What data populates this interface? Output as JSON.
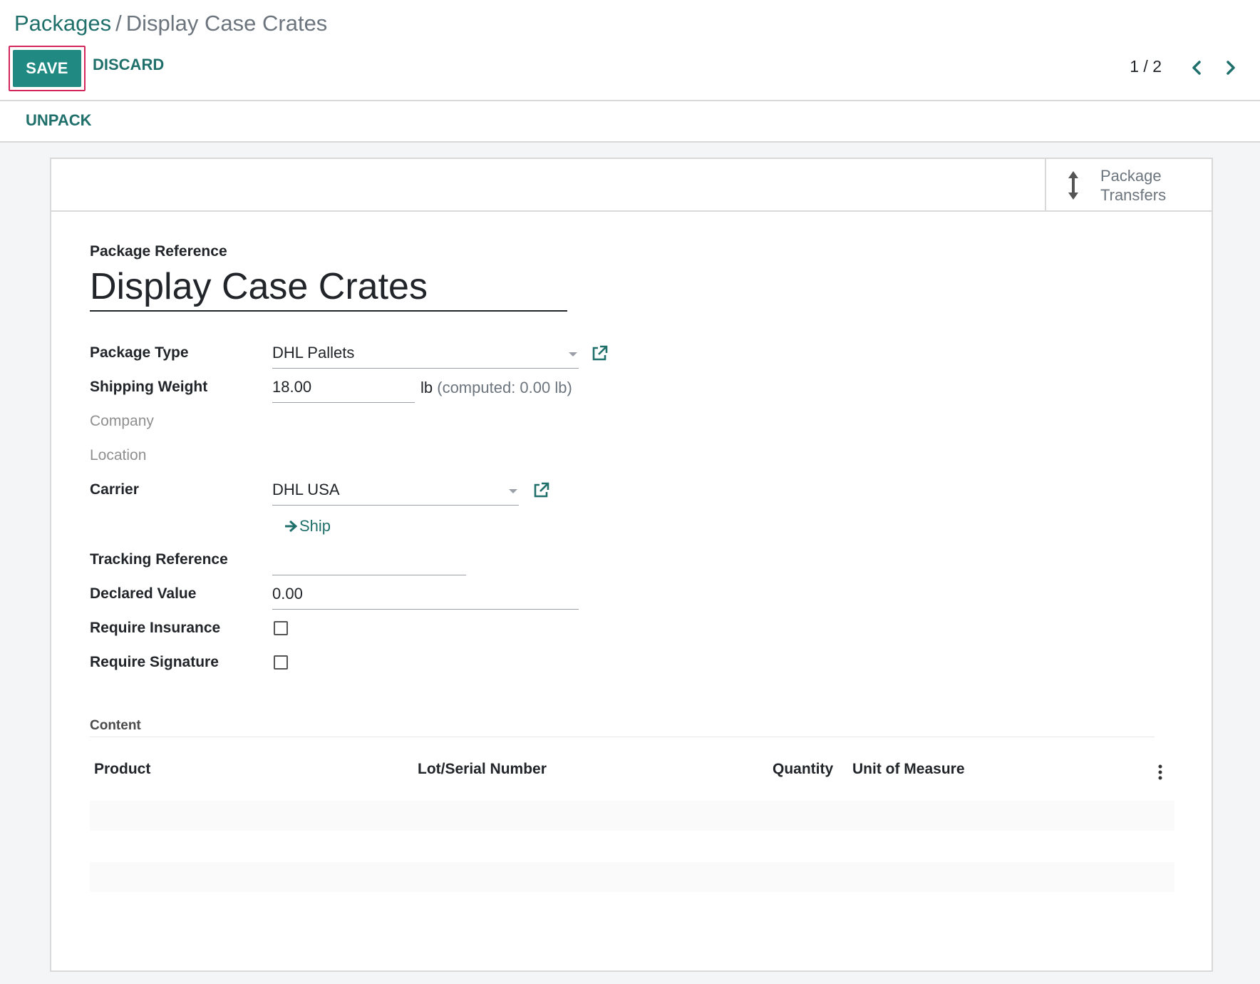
{
  "breadcrumb": {
    "parent": "Packages",
    "separator": "/",
    "current": "Display Case Crates"
  },
  "toolbar": {
    "save_label": "SAVE",
    "discard_label": "DISCARD"
  },
  "pager": {
    "value": "1 / 2"
  },
  "status_bar": {
    "unpack_label": "UNPACK"
  },
  "smart_button": {
    "line1": "Package",
    "line2": "Transfers"
  },
  "form": {
    "reference_label": "Package Reference",
    "reference_value": "Display Case Crates",
    "package_type_label": "Package Type",
    "package_type_value": "DHL Pallets",
    "shipping_weight_label": "Shipping Weight",
    "shipping_weight_value": "18.00",
    "weight_unit": "lb",
    "computed_weight": "(computed: 0.00  lb)",
    "company_label": "Company",
    "location_label": "Location",
    "carrier_label": "Carrier",
    "carrier_value": "DHL USA",
    "ship_label": "Ship",
    "tracking_label": "Tracking Reference",
    "tracking_value": "",
    "declared_value_label": "Declared Value",
    "declared_value": "0.00",
    "insurance_label": "Require Insurance",
    "insurance_checked": false,
    "signature_label": "Require Signature",
    "signature_checked": false
  },
  "content": {
    "section_title": "Content",
    "columns": [
      "Product",
      "Lot/Serial Number",
      "Quantity",
      "Unit of Measure"
    ],
    "rows": []
  },
  "colors": {
    "primary": "#208a82",
    "link": "#1f6f6b",
    "highlight_border": "#d2275a"
  }
}
